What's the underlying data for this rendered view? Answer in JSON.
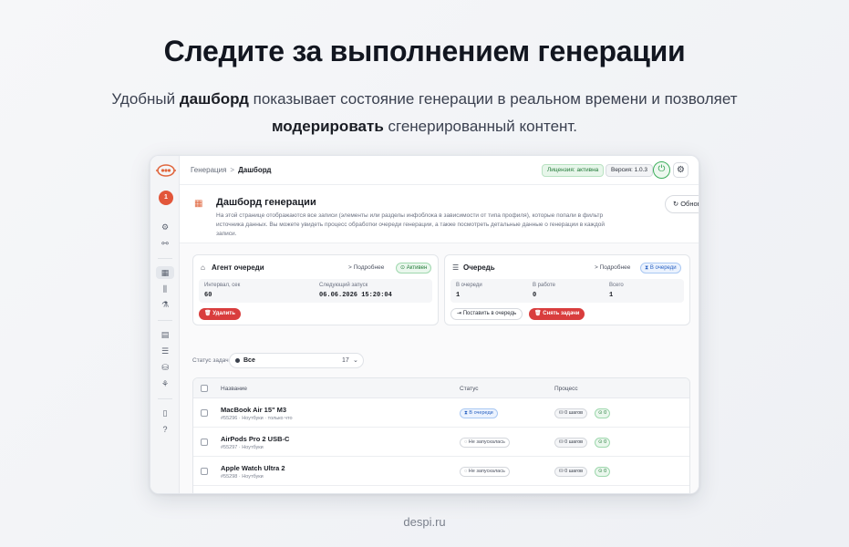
{
  "hero": {
    "title": "Следите за выполнением генерации",
    "sub_1": "Удобный ",
    "sub_bold_1": "дашборд",
    "sub_2": " показывает состояние генерации в реальном времени и позволяет ",
    "sub_bold_2": "модерировать",
    "sub_3": " сгенерированный контент."
  },
  "footer": "despi.ru",
  "app": {
    "avatar": "1",
    "breadcrumb": {
      "parent": "Генерация",
      "sep": ">",
      "current": "Дашборд"
    },
    "license": "Лицензия: активна",
    "version": "Версия: 1.0.3",
    "icons": {
      "power": "⏻",
      "gear": "⚙"
    },
    "header": {
      "title": "Дашборд генерации",
      "description": "На этой странице отображаются все записи (элементы или разделы инфоблока в зависимости от типа профиля), которые попали в фильтр источника данных. Вы можете увидеть процесс обработки очереди генерации, а также посмотреть детальные данные о генерации в каждой записи.",
      "refresh": "↻ Обновить"
    },
    "agent_card": {
      "title": "Агент очереди",
      "more": "> Подробнее",
      "badge": "⊙ Активен",
      "interval_label": "Интервал, сек",
      "interval_value": "60",
      "next_label": "Следующий запуск",
      "next_value": "06.06.2026 15:20:04",
      "delete_btn": "🗑 Удалить"
    },
    "queue_card": {
      "title": "Очередь",
      "more": "> Подробнее",
      "badge": "⧗ В очереди",
      "in_queue_label": "В очереди",
      "in_queue_value": "1",
      "in_work_label": "В работе",
      "in_work_value": "0",
      "total_label": "Всего",
      "total_value": "1",
      "enqueue_btn": "⇥ Поставить в очередь",
      "remove_btn": "🗑 Снять задачи"
    },
    "filter": {
      "label": "Статус задач",
      "value": "Все",
      "count": "17",
      "chevron": "⌄"
    },
    "table": {
      "col_name": "Название",
      "col_status": "Статус",
      "col_process": "Процесс",
      "rows": [
        {
          "name": "MacBook Air 15\" M3",
          "meta": "#55296 · Ноутбуки · только что",
          "status": "⧗ В очереди",
          "steps": "⛁ 0 шагов",
          "ok": "⊙ 0"
        },
        {
          "name": "AirPods Pro 2 USB-C",
          "meta": "#55297 · Ноутбуки",
          "status": "◌ Не запускалась",
          "steps": "⛁ 0 шагов",
          "ok": "⊙ 0"
        },
        {
          "name": "Apple Watch Ultra 2",
          "meta": "#55298 · Ноутбуки",
          "status": "◌ Не запускалась",
          "steps": "⛁ 0 шагов",
          "ok": "⊙ 0"
        }
      ]
    }
  }
}
